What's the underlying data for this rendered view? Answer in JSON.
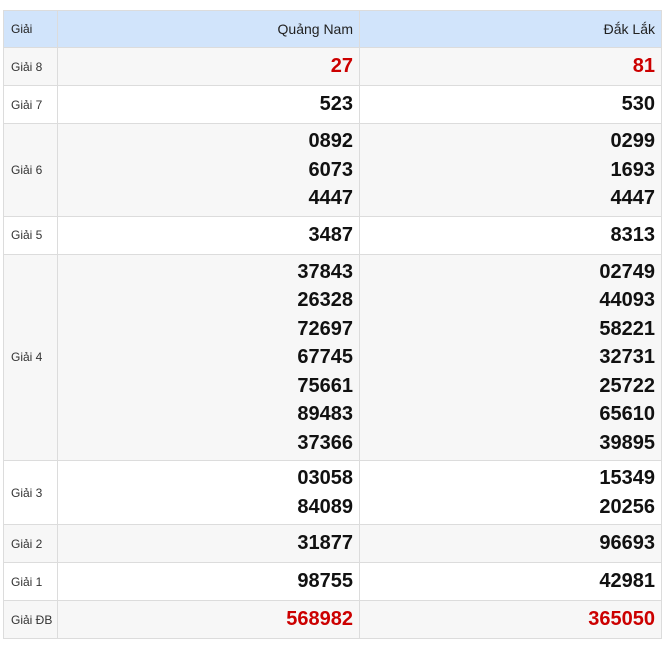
{
  "header": {
    "label": "Giải",
    "provinces": [
      "Quảng Nam",
      "Đắk Lắk"
    ]
  },
  "rows": [
    {
      "label": "Giải 8",
      "a": [
        "27"
      ],
      "b": [
        "81"
      ],
      "highlight": true
    },
    {
      "label": "Giải 7",
      "a": [
        "523"
      ],
      "b": [
        "530"
      ]
    },
    {
      "label": "Giải 6",
      "a": [
        "0892",
        "6073",
        "4447"
      ],
      "b": [
        "0299",
        "1693",
        "4447"
      ]
    },
    {
      "label": "Giải 5",
      "a": [
        "3487"
      ],
      "b": [
        "8313"
      ]
    },
    {
      "label": "Giải 4",
      "a": [
        "37843",
        "26328",
        "72697",
        "67745",
        "75661",
        "89483",
        "37366"
      ],
      "b": [
        "02749",
        "44093",
        "58221",
        "32731",
        "25722",
        "65610",
        "39895"
      ]
    },
    {
      "label": "Giải 3",
      "a": [
        "03058",
        "84089"
      ],
      "b": [
        "15349",
        "20256"
      ]
    },
    {
      "label": "Giải 2",
      "a": [
        "31877"
      ],
      "b": [
        "96693"
      ]
    },
    {
      "label": "Giải 1",
      "a": [
        "98755"
      ],
      "b": [
        "42981"
      ]
    },
    {
      "label": "Giải ĐB",
      "a": [
        "568982"
      ],
      "b": [
        "365050"
      ],
      "highlight": true
    }
  ],
  "colors": {
    "header_bg": "#d1e4fb",
    "highlight": "#cc0000",
    "row_alt": "#f7f7f7"
  }
}
